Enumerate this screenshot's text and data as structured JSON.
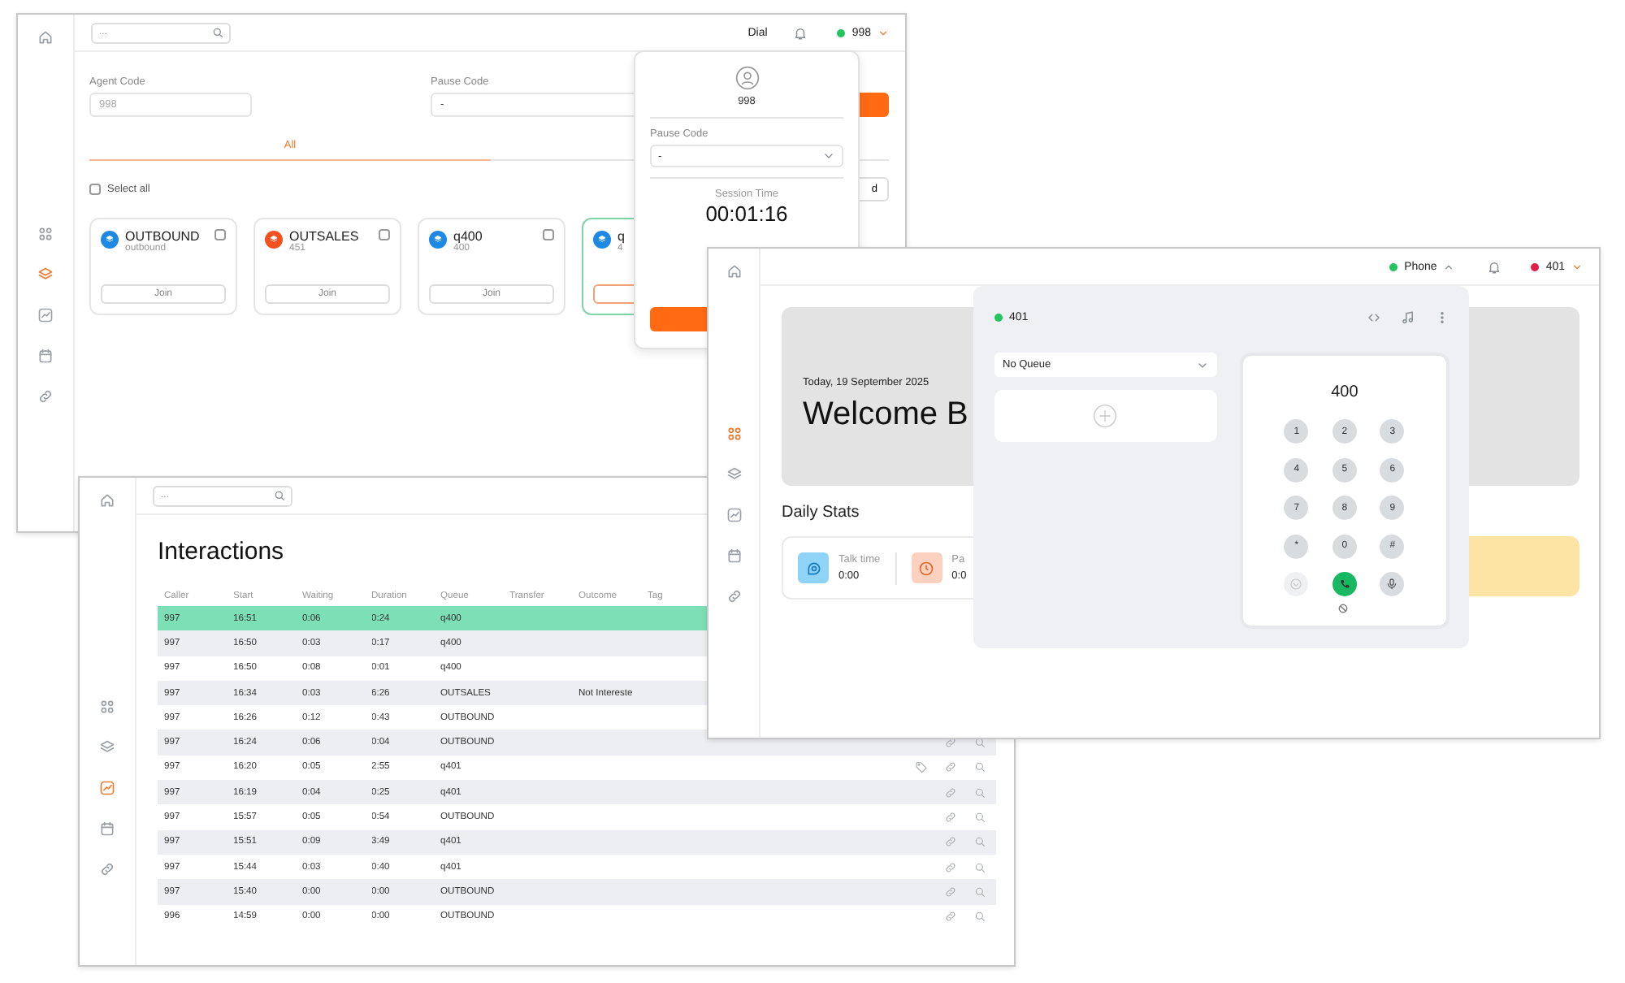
{
  "queues_window": {
    "sidebar": [
      {
        "selected": false
      },
      {
        "selected": true
      },
      {
        "selected": false
      },
      {
        "selected": false
      },
      {
        "selected": false
      }
    ],
    "search": {
      "placeholder": "..."
    },
    "header": {
      "dial": "Dial",
      "user": {
        "label": "998",
        "available": true
      }
    },
    "agent_code": {
      "label": "Agent Code",
      "value": "998",
      "disabled": true
    },
    "pause_code": {
      "label": "Pause Code",
      "value": "-"
    },
    "tabs": [
      {
        "label": "All",
        "selected": true
      }
    ],
    "select_all": {
      "label": "Select all",
      "checked": false
    },
    "partial_button": "d",
    "queues": [
      {
        "name": "OUTBOUND",
        "number": "outbound",
        "color": "#1e88e5",
        "checked": false,
        "joined": false,
        "button": "Join"
      },
      {
        "name": "OUTSALES",
        "number": "451",
        "color": "#f4511e",
        "checked": false,
        "joined": false,
        "button": "Join"
      },
      {
        "name": "q400",
        "number": "400",
        "color": "#1e88e5",
        "checked": false,
        "joined": false,
        "button": "Join"
      },
      {
        "name": "q",
        "number": "4",
        "color": "#1e88e5",
        "joined": true
      }
    ],
    "user_menu": {
      "user": "998",
      "pause_code": {
        "label": "Pause Code",
        "value": "-"
      },
      "session": {
        "label": "Session Time",
        "value": "00:01:16"
      }
    }
  },
  "interactions_window": {
    "sidebar": [
      {
        "selected": false
      },
      {
        "selected": false
      },
      {
        "selected": true
      },
      {
        "selected": false
      },
      {
        "selected": false
      }
    ],
    "search": {
      "placeholder": "..."
    },
    "title": "Interactions",
    "columns": [
      "Caller",
      "Start",
      "Waiting",
      "Duration",
      "Queue",
      "Transfer",
      "Outcome",
      "Tag"
    ],
    "rows": [
      {
        "caller": "997",
        "start": "16:51",
        "waiting": "0:06",
        "duration": "0:24",
        "queue": "q400",
        "selected": true
      },
      {
        "caller": "997",
        "start": "16:50",
        "waiting": "0:03",
        "duration": "0:17",
        "queue": "q400",
        "selected": false
      },
      {
        "caller": "997",
        "start": "16:50",
        "waiting": "0:08",
        "duration": "0:01",
        "queue": "q400",
        "selected": false
      },
      {
        "caller": "997",
        "start": "16:34",
        "waiting": "0:03",
        "duration": "6:26",
        "queue": "OUTSALES",
        "outcome": "Not Intereste",
        "selected": false
      },
      {
        "caller": "997",
        "start": "16:26",
        "waiting": "0:12",
        "duration": "0:43",
        "queue": "OUTBOUND",
        "selected": false
      },
      {
        "caller": "997",
        "start": "16:24",
        "waiting": "0:06",
        "duration": "0:04",
        "queue": "OUTBOUND",
        "selected": false,
        "tagged": false
      },
      {
        "caller": "997",
        "start": "16:20",
        "waiting": "0:05",
        "duration": "2:55",
        "queue": "q401",
        "selected": false,
        "tagged": true
      },
      {
        "caller": "997",
        "start": "16:19",
        "waiting": "0:04",
        "duration": "0:25",
        "queue": "q401",
        "selected": false,
        "tagged": false
      },
      {
        "caller": "997",
        "start": "15:57",
        "waiting": "0:05",
        "duration": "0:54",
        "queue": "OUTBOUND",
        "selected": false,
        "tagged": false
      },
      {
        "caller": "997",
        "start": "15:51",
        "waiting": "0:09",
        "duration": "3:49",
        "queue": "q401",
        "selected": false,
        "tagged": false
      },
      {
        "caller": "997",
        "start": "15:44",
        "waiting": "0:03",
        "duration": "0:40",
        "queue": "q401",
        "selected": false,
        "tagged": false
      },
      {
        "caller": "997",
        "start": "15:40",
        "waiting": "0:00",
        "duration": "0:00",
        "queue": "OUTBOUND",
        "selected": false,
        "tagged": false
      },
      {
        "caller": "996",
        "start": "14:59",
        "waiting": "0:00",
        "duration": "0:00",
        "queue": "OUTBOUND",
        "selected": false,
        "tagged": false
      }
    ]
  },
  "home_window": {
    "sidebar": [
      {
        "selected": true
      },
      {
        "selected": false
      },
      {
        "selected": false
      },
      {
        "selected": false
      },
      {
        "selected": false
      }
    ],
    "header": {
      "phone": {
        "label": "Phone",
        "available": true
      },
      "user": {
        "label": "401",
        "available": false
      }
    },
    "banner": {
      "date": "Today, 19 September 2025",
      "title": "Welcome B"
    },
    "daily_stats": {
      "title": "Daily Stats",
      "items": [
        {
          "kind": "talk",
          "label": "Talk time",
          "value": "0:00"
        },
        {
          "kind": "pause",
          "label": "Pa",
          "value": "0:0"
        }
      ]
    },
    "dialer": {
      "line": {
        "label": "401",
        "available": true
      },
      "queue_select": "No Queue",
      "number": "400",
      "keys": [
        "1",
        "2",
        "3",
        "4",
        "5",
        "6",
        "7",
        "8",
        "9",
        "*",
        "0",
        "#"
      ]
    }
  }
}
